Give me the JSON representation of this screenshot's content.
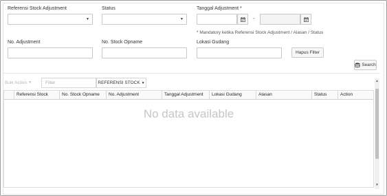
{
  "form": {
    "ref_label": "Referensi Stock Adjustment",
    "status_label": "Status",
    "date_label": "Tanggal Adjustment *",
    "date_separator": "-",
    "mandatory_note": "* Mandatory ketika Referensi Stock Adjustment / Alasan / Status",
    "no_adj_label": "No. Adjustment",
    "no_opname_label": "No. Stock Opname",
    "lokasi_label": "Lokasi Gudang",
    "hapus_filter": "Hapus Filter",
    "search": "Search"
  },
  "toolbar": {
    "bulk_action": "Bulk Action",
    "filter_placeholder": "Filter",
    "ref_dropdown": "REFERENSI STOCK"
  },
  "table": {
    "columns": [
      "Referensi Stock",
      "No. Stock Opname",
      "No. Adjustment",
      "Tanggal Adjustment",
      "Lokasi Gudang",
      "Alasan",
      "Status",
      "Action"
    ],
    "empty_text": "No data available"
  },
  "icons": {
    "calendar": "calendar-icon",
    "caret": "caret-down-icon",
    "search": "database-search-icon"
  }
}
